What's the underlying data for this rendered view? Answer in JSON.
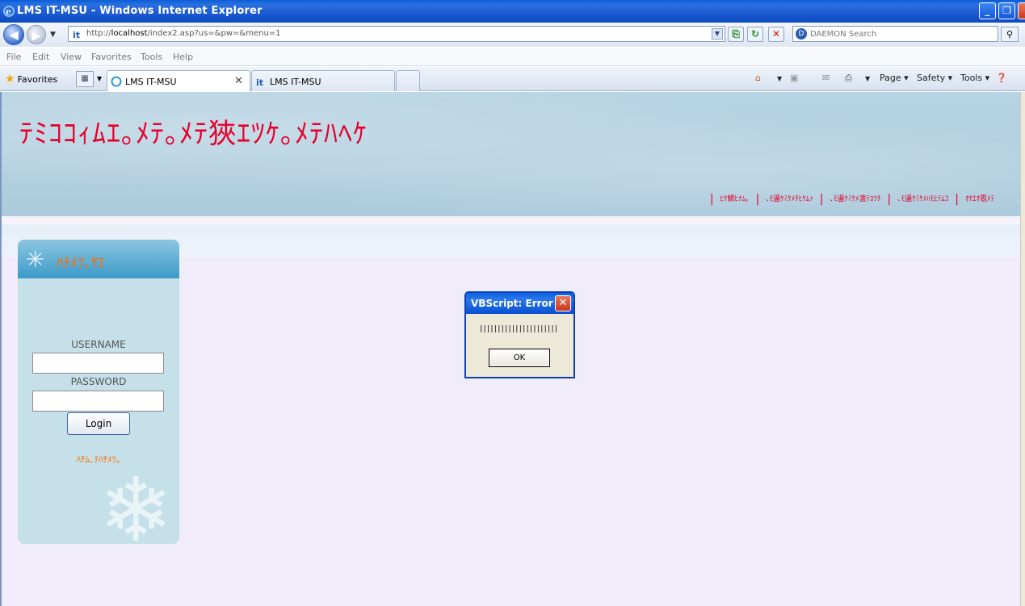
{
  "window": {
    "title": "LMS IT-MSU - Windows Internet Explorer",
    "min_glyph": "_",
    "max_glyph": "❐",
    "close_glyph": "✕"
  },
  "address": {
    "url_prefix": "http://",
    "url_host": "localhost",
    "url_rest": "/index2.asp?us=&pw=&menu=1",
    "search_placeholder": "DAEMON Search"
  },
  "menu": {
    "file": "File",
    "edit": "Edit",
    "view": "View",
    "favorites": "Favorites",
    "tools": "Tools",
    "help": "Help"
  },
  "favorites_bar": {
    "label": "Favorites",
    "tabs": [
      {
        "label": "LMS IT-MSU",
        "active": true
      },
      {
        "label": "LMS IT-MSU",
        "active": false
      }
    ],
    "commands": {
      "page": "Page ▾",
      "safety": "Safety ▾",
      "tools": "Tools ▾"
    }
  },
  "site": {
    "title": "ﾃﾐｺｺｨﾑｴ｡ﾒﾃ｡ﾒﾃ狹ｴﾂｹ｡ﾒﾃﾊﾍｹ",
    "nav": [
      "ﾋｹ鰓ﾋﾅﾑ｡",
      "､ﾓ盪ｹﾐｹﾒﾁﾋｹﾑｧ",
      "､ﾓ盪ｹﾐｹﾒ盞ﾃﾕﾂﾁ",
      "､ﾓ盪ｹﾐｹﾒﾊﾓﾋﾃﾑｺ",
      "ｵﾔｴｵ雹ﾒﾃ"
    ]
  },
  "login": {
    "header": "ﾊﾁﾒﾂ､ﾔｴ",
    "username_label": "USERNAME",
    "username_value": "",
    "password_label": "PASSWORD",
    "password_value": "",
    "login_button": "Login",
    "register_link": "ﾊﾁﾑ､ﾃﾊﾁﾒﾂ｡"
  },
  "dialog": {
    "title": "VBScript: Error",
    "message": "||||||||||||||||||||||",
    "ok": "OK"
  }
}
